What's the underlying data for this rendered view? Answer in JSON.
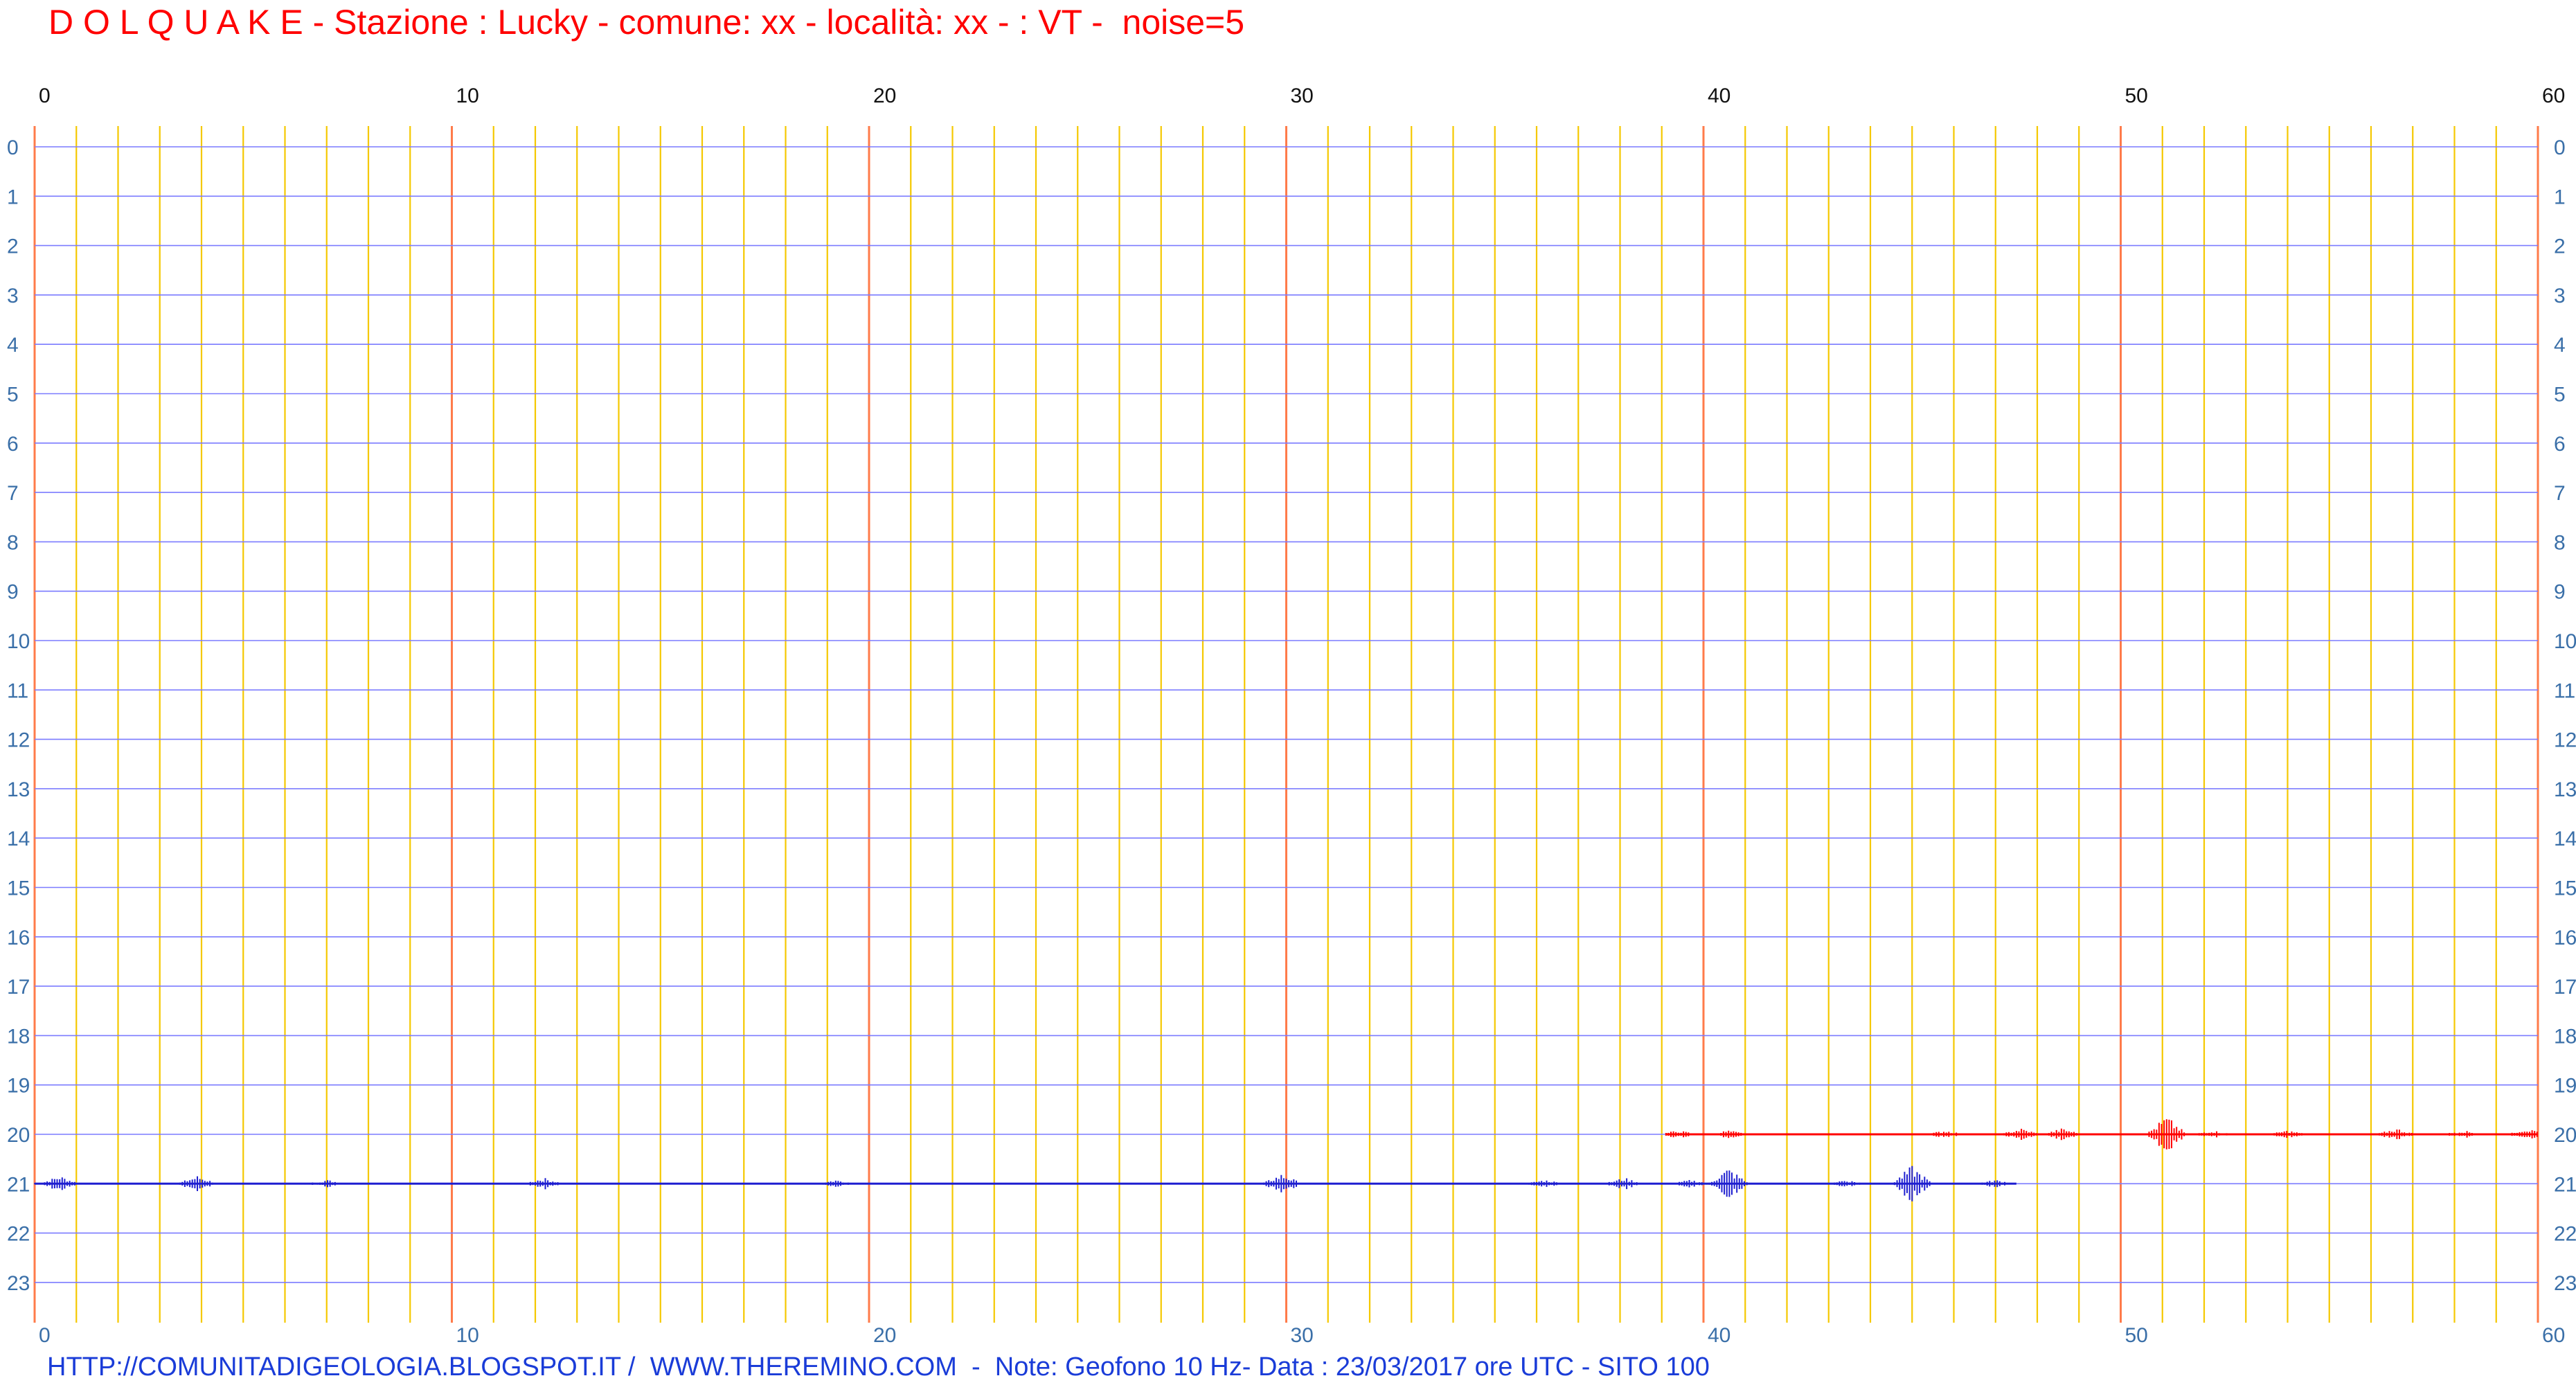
{
  "title": "D O L Q U A K E - Stazione : Lucky - comune: xx - località: xx - : VT -  noise=5",
  "footer": "HTTP://COMUNITADIGEOLOGIA.BLOGSPOT.IT /  WWW.THEREMINO.COM  -  Note: Geofono 10 Hz- Data : 23/03/2017 ore UTC - SITO 100",
  "colors": {
    "title": "#ff0000",
    "footer": "#1a3cd8",
    "hour_grid": "#7b7bff",
    "minute_grid": "#f5c800",
    "ten_minute_grid": "#ff7b4a",
    "axis_label": "#3a6fa8",
    "top_label": "#111111",
    "trace_previous_hour": "#1f1fd0",
    "trace_current_hour": "#ff0000"
  },
  "chart_data": {
    "type": "line",
    "xlabel": "",
    "ylabel": "",
    "x_range": [
      0,
      60
    ],
    "y_range": [
      0,
      23
    ],
    "x_ticks": [
      "0",
      "10",
      "20",
      "30",
      "40",
      "50",
      "60"
    ],
    "y_ticks": [
      "0",
      "1",
      "2",
      "3",
      "4",
      "5",
      "6",
      "7",
      "8",
      "9",
      "10",
      "11",
      "12",
      "13",
      "14",
      "15",
      "16",
      "17",
      "18",
      "19",
      "20",
      "21",
      "22",
      "23"
    ],
    "grid": true,
    "series": [
      {
        "hour": 21,
        "color": "#1f1fd0",
        "start_min": 0,
        "end_min": 47.5,
        "baseline_noise": 1,
        "events": [
          {
            "min": 0.6,
            "amp": 4
          },
          {
            "min": 3.9,
            "amp": 4
          },
          {
            "min": 7.0,
            "amp": 2
          },
          {
            "min": 12.2,
            "amp": 3
          },
          {
            "min": 19.2,
            "amp": 2
          },
          {
            "min": 29.9,
            "amp": 5
          },
          {
            "min": 36.2,
            "amp": 2
          },
          {
            "min": 38.1,
            "amp": 3
          },
          {
            "min": 39.7,
            "amp": 2
          },
          {
            "min": 40.6,
            "amp": 8
          },
          {
            "min": 43.4,
            "amp": 2
          },
          {
            "min": 45.0,
            "amp": 9
          },
          {
            "min": 47.0,
            "amp": 2
          }
        ]
      },
      {
        "hour": 20,
        "color": "#ff0000",
        "start_min": 39.1,
        "end_min": 60,
        "baseline_noise": 1,
        "events": [
          {
            "min": 39.4,
            "amp": 2
          },
          {
            "min": 40.6,
            "amp": 2
          },
          {
            "min": 45.8,
            "amp": 2
          },
          {
            "min": 47.6,
            "amp": 3
          },
          {
            "min": 48.6,
            "amp": 3
          },
          {
            "min": 51.1,
            "amp": 9
          },
          {
            "min": 52.2,
            "amp": 2
          },
          {
            "min": 54.0,
            "amp": 2
          },
          {
            "min": 56.6,
            "amp": 3
          },
          {
            "min": 58.2,
            "amp": 2
          },
          {
            "min": 59.7,
            "amp": 3
          }
        ]
      }
    ]
  }
}
